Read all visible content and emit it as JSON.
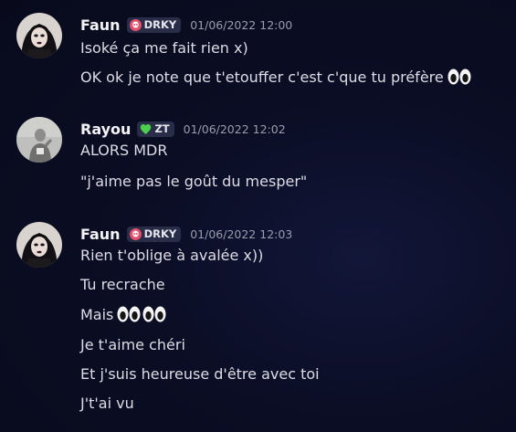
{
  "messages": [
    {
      "author": "Faun",
      "tag": {
        "icon": "skull-icon",
        "label": "DRKY",
        "color": "#e2506b"
      },
      "timestamp": "01/06/2022 12:00",
      "avatar": "goth-avatar",
      "lines": [
        {
          "text": "Isoké ça me fait rien x)"
        },
        {
          "text": "OK ok je note que t'etouffer c'est c'que tu préfère",
          "emoji": "eyes-icon",
          "emoji_count": 1
        }
      ]
    },
    {
      "author": "Rayou",
      "tag": {
        "icon": "green-heart-icon",
        "label": "ZT",
        "color": "#4ccf4c"
      },
      "timestamp": "01/06/2022 12:02",
      "avatar": "grey-avatar",
      "lines": [
        {
          "text": "ALORS MDR"
        },
        {
          "text": "\"j'aime pas le goût du mesper\""
        }
      ]
    },
    {
      "author": "Faun",
      "tag": {
        "icon": "skull-icon",
        "label": "DRKY",
        "color": "#e2506b"
      },
      "timestamp": "01/06/2022 12:03",
      "avatar": "goth-avatar",
      "lines": [
        {
          "text": "Rien t'oblige à avalée x))"
        },
        {
          "text": "Tu recrache"
        },
        {
          "text": "Mais",
          "emoji": "eyes-icon",
          "emoji_count": 2
        },
        {
          "text": "Je t'aime chéri"
        },
        {
          "text": "Et j'suis heureuse d'être avec toi"
        },
        {
          "text": "J't'ai vu"
        }
      ]
    }
  ]
}
